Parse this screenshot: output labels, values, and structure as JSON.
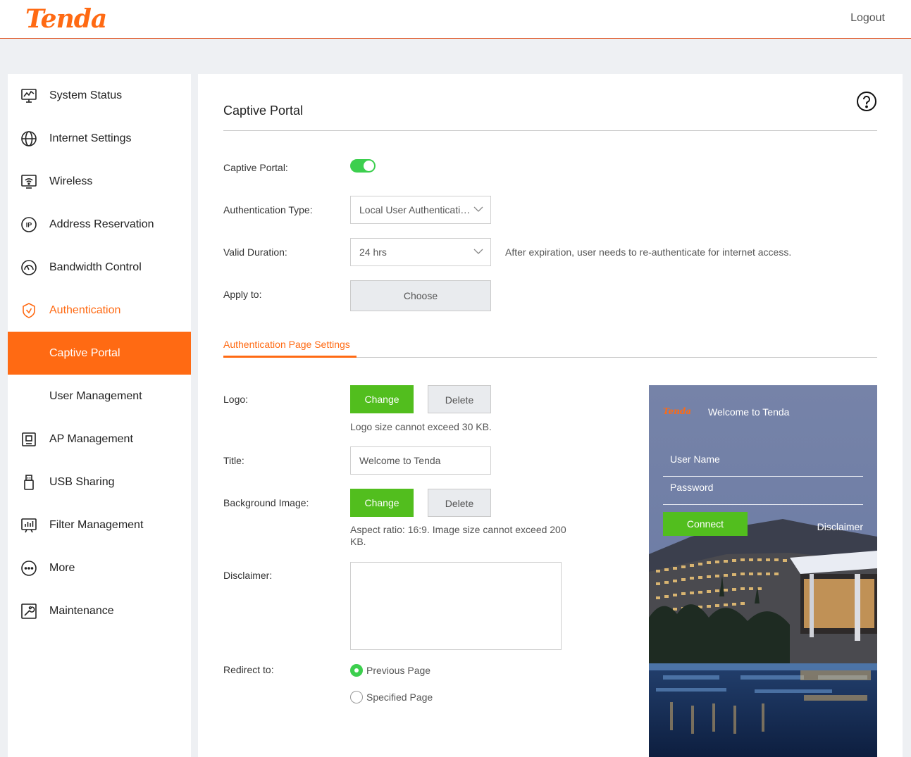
{
  "header": {
    "logo": "Tenda",
    "logout_label": "Logout"
  },
  "sidebar": {
    "items": [
      {
        "label": "System Status",
        "icon": "monitor-chart-icon"
      },
      {
        "label": "Internet Settings",
        "icon": "globe-icon"
      },
      {
        "label": "Wireless",
        "icon": "wifi-screen-icon"
      },
      {
        "label": "Address Reservation",
        "icon": "ip-icon"
      },
      {
        "label": "Bandwidth Control",
        "icon": "gauge-icon"
      },
      {
        "label": "Authentication",
        "icon": "shield-check-icon"
      },
      {
        "label": "Captive Portal"
      },
      {
        "label": "User Management"
      },
      {
        "label": "AP Management",
        "icon": "ap-device-icon"
      },
      {
        "label": "USB Sharing",
        "icon": "usb-icon"
      },
      {
        "label": "Filter Management",
        "icon": "bar-chart-icon"
      },
      {
        "label": "More",
        "icon": "more-dots-icon"
      },
      {
        "label": "Maintenance",
        "icon": "wrench-icon"
      }
    ]
  },
  "main": {
    "title": "Captive Portal",
    "captive_portal_label": "Captive Portal:",
    "captive_portal_enabled": true,
    "auth_type_label": "Authentication Type:",
    "auth_type_value": "Local User Authentication",
    "valid_duration_label": "Valid Duration:",
    "valid_duration_value": "24 hrs",
    "valid_duration_note": "After expiration, user needs to re-authenticate for internet access.",
    "apply_to_label": "Apply to:",
    "choose_label": "Choose",
    "subtab_label": "Authentication Page Settings",
    "logo_label": "Logo:",
    "change_label": "Change",
    "delete_label": "Delete",
    "logo_note": "Logo size cannot exceed 30 KB.",
    "title_label": "Title:",
    "title_value": "Welcome to Tenda",
    "bg_label": "Background Image:",
    "bg_note_line1": "Aspect ratio: 16:9. Image size cannot exceed 200",
    "bg_note_line2": "KB.",
    "disclaimer_label": "Disclaimer:",
    "disclaimer_value": "",
    "redirect_label": "Redirect to:",
    "redirect_options": [
      "Previous Page",
      "Specified Page"
    ],
    "redirect_selected": "Previous Page"
  },
  "preview": {
    "logo": "Tenda",
    "title": "Welcome to Tenda",
    "username_placeholder": "User Name",
    "password_placeholder": "Password",
    "connect_label": "Connect",
    "disclaimer_label": "Disclaimer"
  },
  "colors": {
    "accent": "#ff6a13",
    "green": "#52be1e",
    "toggle_on": "#3ccf4e"
  }
}
